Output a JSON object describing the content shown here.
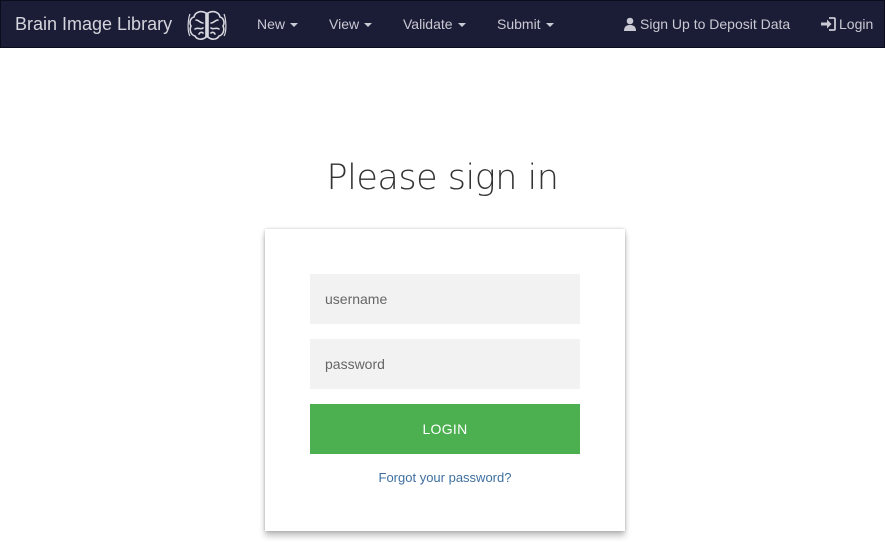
{
  "navbar": {
    "brand": "Brain Image Library",
    "items": [
      {
        "label": "New"
      },
      {
        "label": "View"
      },
      {
        "label": "Validate"
      },
      {
        "label": "Submit"
      }
    ],
    "signup_label": "Sign Up to Deposit Data",
    "login_label": "Login",
    "icons": {
      "brand": "brain-icon",
      "signup": "user-icon",
      "login": "sign-in-icon",
      "dropdown": "caret-down-icon"
    }
  },
  "page": {
    "title": "Please sign in"
  },
  "form": {
    "username_placeholder": "username",
    "password_placeholder": "password",
    "login_button": "LOGIN",
    "forgot_link": "Forgot your password?"
  },
  "colors": {
    "navbar_bg": "#1b1c36",
    "login_button": "#4caf50",
    "input_bg": "#f2f2f2",
    "link": "#3f6fa0"
  }
}
